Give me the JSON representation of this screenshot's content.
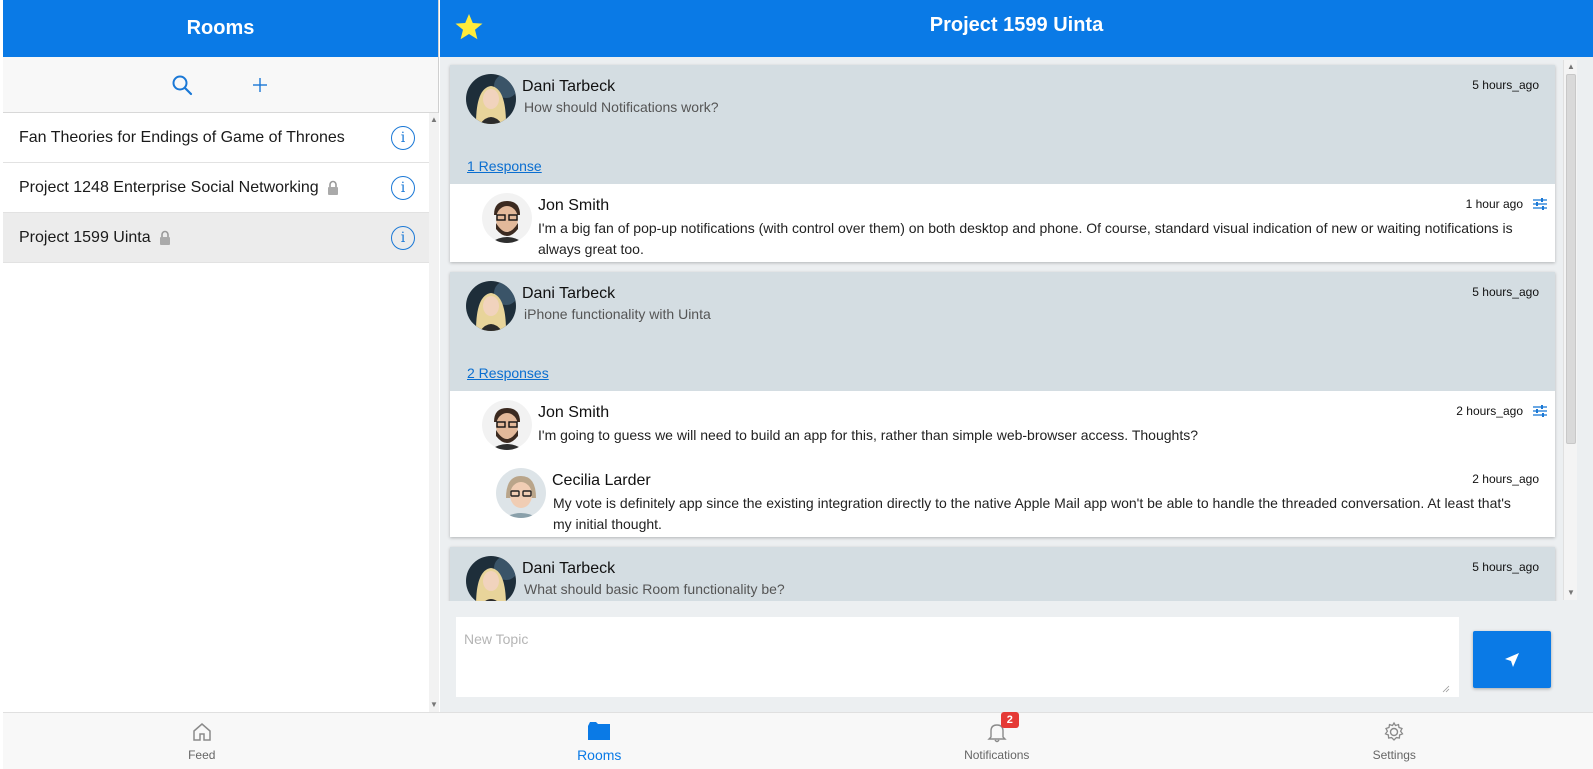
{
  "left": {
    "title": "Rooms",
    "rooms": [
      {
        "name": "Fan Theories for Endings of Game of Thrones",
        "locked": false
      },
      {
        "name": "Project 1248 Enterprise Social Networking",
        "locked": true
      },
      {
        "name": "Project 1599 Uinta",
        "locked": true
      }
    ]
  },
  "right": {
    "title": "Project 1599 Uinta",
    "topics": [
      {
        "author": "Dani Tarbeck",
        "subject": "How should Notifications work?",
        "time": "5 hours_ago",
        "responses_label": "1 Response",
        "replies": [
          {
            "author": "Jon Smith",
            "time": "1 hour ago",
            "text": "I'm a big fan of pop-up notifications (with control over them) on both desktop and phone. Of course, standard visual indication of new or waiting notifications is always great too."
          }
        ]
      },
      {
        "author": "Dani Tarbeck",
        "subject": "iPhone functionality with Uinta",
        "time": "5 hours_ago",
        "responses_label": "2 Responses",
        "replies": [
          {
            "author": "Jon Smith",
            "time": "2 hours_ago",
            "text": "I'm going to guess we will need to build an app for this, rather than simple web-browser access. Thoughts?"
          },
          {
            "author": "Cecilia Larder",
            "time": "2 hours_ago",
            "text": "My vote is definitely app since the existing integration directly to the native Apple Mail app won't be able to handle the threaded conversation. At least that's my initial thought."
          }
        ]
      },
      {
        "author": "Dani Tarbeck",
        "subject": "What should basic Room functionality be?",
        "time": "5 hours_ago"
      }
    ],
    "composer": {
      "placeholder": "New Topic"
    }
  },
  "nav": {
    "items": [
      {
        "label": "Feed",
        "icon": "home-icon"
      },
      {
        "label": "Rooms",
        "icon": "folder-icon"
      },
      {
        "label": "Notifications",
        "icon": "bell-icon",
        "badge": "2"
      },
      {
        "label": "Settings",
        "icon": "gear-icon"
      }
    ]
  },
  "colors": {
    "primary": "#0a7ae6",
    "topic_header_bg": "#d4dde2",
    "badge": "#e53935",
    "star": "#ffeb3b"
  }
}
